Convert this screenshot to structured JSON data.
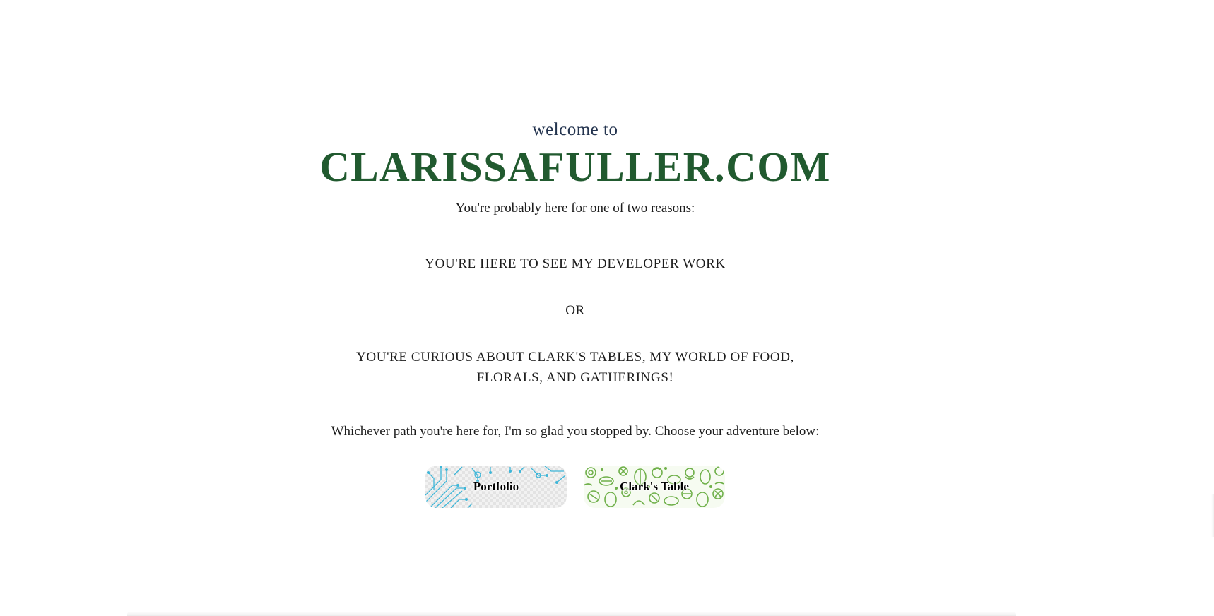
{
  "hero": {
    "welcome": "welcome to",
    "site_title": "CLARISSAFULLER.COM",
    "intro": "You're probably here for one of two reasons:",
    "reason_one": "YOU'RE HERE TO SEE MY DEVELOPER WORK",
    "or_text": "OR",
    "reason_two_line1": "YOU'RE CURIOUS ABOUT CLARK'S TABLES, MY WORLD OF FOOD,",
    "reason_two_line2": "FLORALS, AND GATHERINGS!",
    "outro": "Whichever path you're here for, I'm so glad you stopped by. Choose your adventure below:"
  },
  "buttons": {
    "portfolio_label": "Portfolio",
    "clarks_label": "Clark's Table"
  },
  "colors": {
    "title_green": "#215a2f",
    "welcome_navy": "#24344f",
    "circuit_blue": "#3fb6d8",
    "veggie_green": "#6fb04a"
  },
  "icons": {
    "portfolio_pattern": "circuit-pattern-icon",
    "clarks_pattern": "vegetable-pattern-icon"
  }
}
